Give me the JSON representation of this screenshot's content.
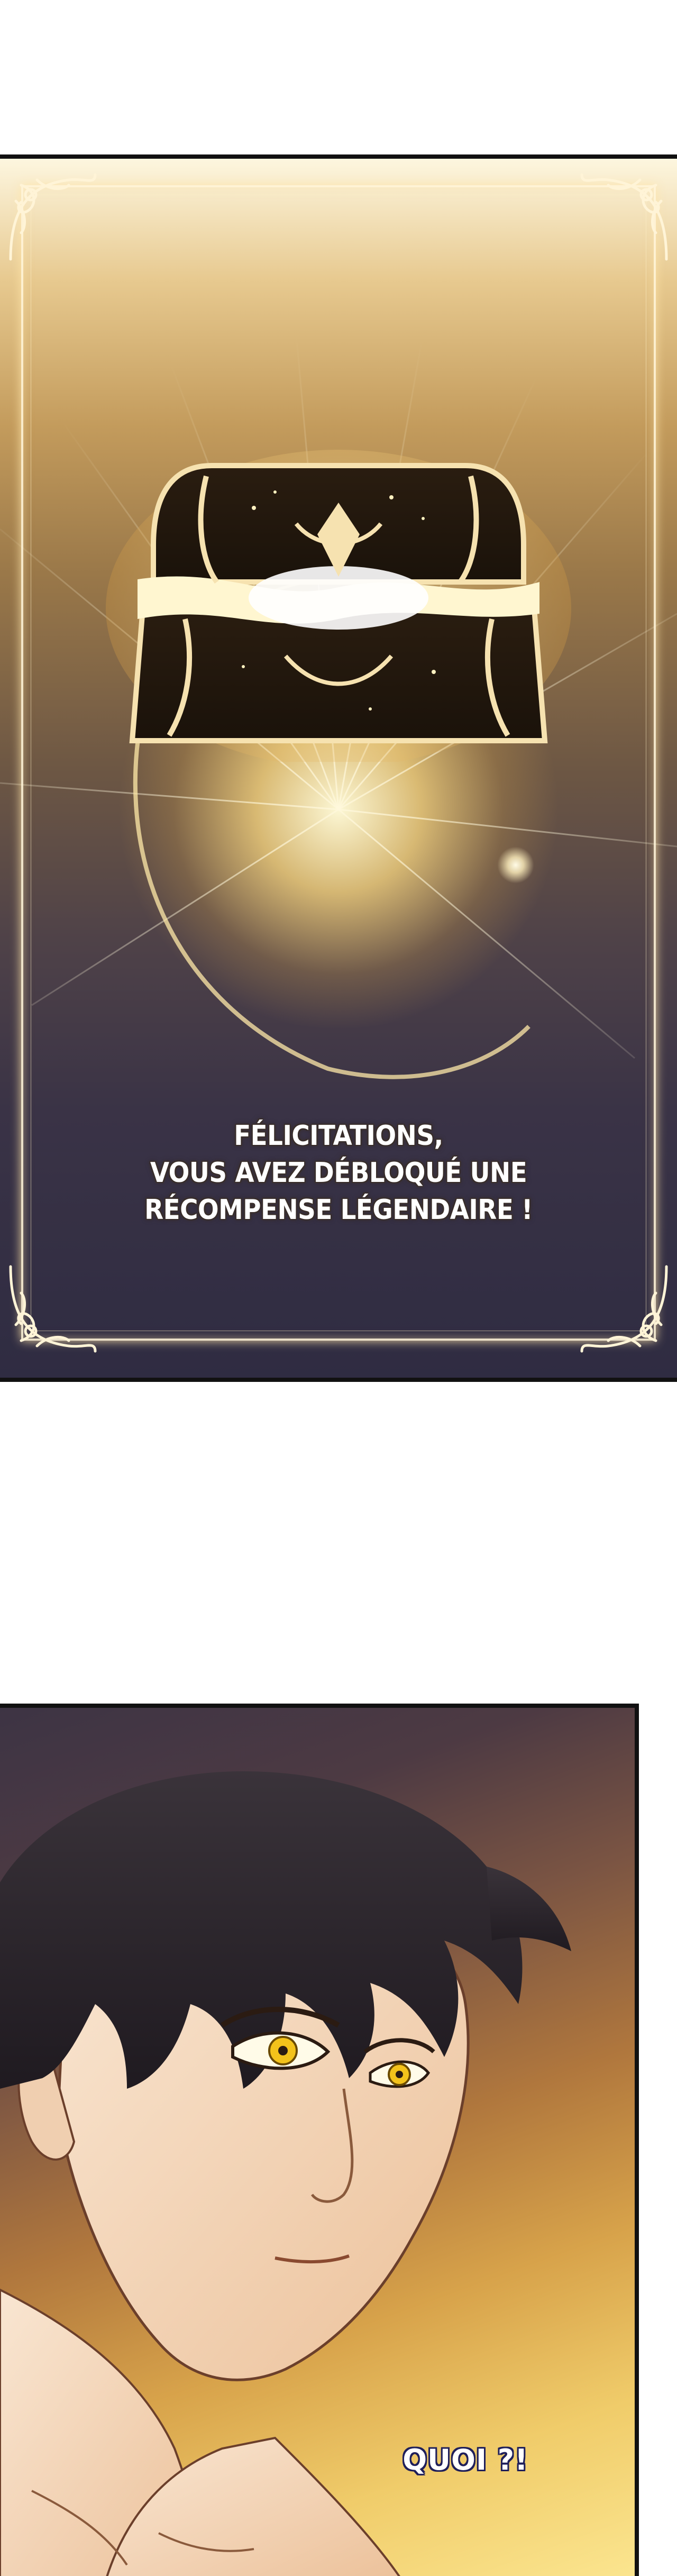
{
  "panel_1": {
    "message_lines": [
      "FÉLICITATIONS,",
      "VOUS AVEZ DÉBLOQUÉ UNE",
      "RÉCOMPENSE LÉGENDAIRE !"
    ],
    "icons": [
      "legendary-chest-icon",
      "ornate-frame-corner-icon"
    ],
    "colors": {
      "glow": "#fff4c2",
      "frame": "#fff4d7",
      "background_top": "#e7c98f",
      "background_bottom": "#2f2c42"
    }
  },
  "panel_2": {
    "speech": "QUOI ?!",
    "colors": {
      "hair": "#2c2630",
      "eyes": "#f3c21b",
      "skin": "#f6dcc2",
      "speech_outline": "#1f1f5a"
    }
  }
}
